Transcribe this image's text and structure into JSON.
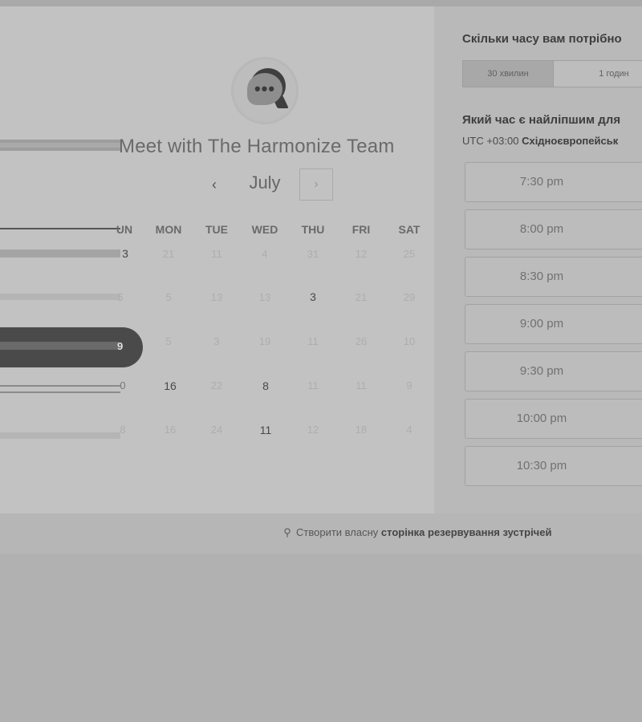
{
  "calendar": {
    "title": "Meet with The Harmonize Team",
    "month": "July",
    "prev_icon": "‹",
    "next_icon": "›",
    "weekdays": [
      "UN",
      "MON",
      "TUE",
      "WED",
      "THU",
      "FRI",
      "SAT"
    ],
    "weeks": [
      [
        "3",
        "21",
        "11",
        "4",
        "31",
        "12",
        "25"
      ],
      [
        "5",
        "5",
        "13",
        "13",
        "3",
        "21",
        "29"
      ],
      [
        "9",
        "5",
        "3",
        "19",
        "11",
        "26",
        "10"
      ],
      [
        "0",
        "16",
        "22",
        "8",
        "11",
        "11",
        "9"
      ],
      [
        "8",
        "16",
        "24",
        "11",
        "12",
        "18",
        "4"
      ]
    ],
    "logo_icon": "chat-bubble-icon",
    "logo_dots": "•••"
  },
  "booking": {
    "duration_question": "Скільки часу вам потрібно",
    "durations": [
      "30 хвилин",
      "1 годин"
    ],
    "time_question": "Який час є найліпшим для",
    "timezone_prefix": "UTC +03:00",
    "timezone_name": "Східноєвропейськ",
    "slots": [
      "7:30 pm",
      "8:00 pm",
      "8:30 pm",
      "9:00 pm",
      "9:30 pm",
      "10:00 pm",
      "10:30 pm"
    ]
  },
  "footer": {
    "icon": "sprocket-icon",
    "icon_glyph": "⚲",
    "text": "Створити власну",
    "link": "сторінка резервування зустрічей"
  },
  "colors": {
    "overlay_bg": "#b3b3b3",
    "selected_day": "#4a4a4a"
  }
}
